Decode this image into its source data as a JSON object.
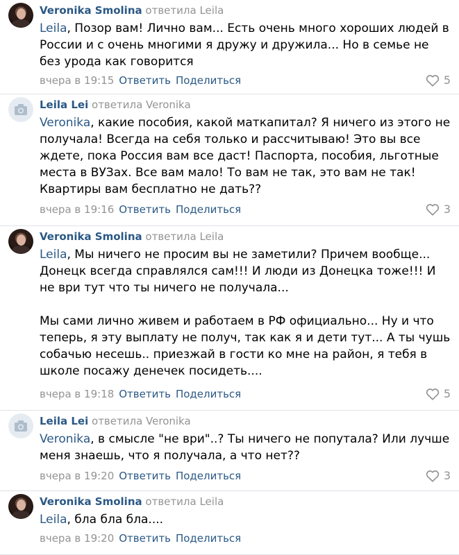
{
  "comments": [
    {
      "author": "Veronika Smolina",
      "replied": "ответила",
      "reply_to": "Leila",
      "mention": "Leila",
      "body": ", Позор вам! Лично вам... Есть очень много хороших людей в России и с очень многими я дружу и дружила... Но в семье не без урода как говорится",
      "date": "вчера в 19:15",
      "reply_label": "Ответить",
      "share_label": "Поделиться",
      "likes": "5",
      "avatar": "photo"
    },
    {
      "author": "Leila Lei",
      "replied": "ответила",
      "reply_to": "Veronika",
      "mention": "Veronika",
      "body": ", какие пособия, какой маткапитал? Я ничего из этого не получала! Всегда на себя только и рассчитываю! Это вы все ждете, пока Россия вам все даст! Паспорта, пособия, льготные места в ВУЗах. Все вам мало! То вам не так, это вам не так! Квартиры вам бесплатно не дать??",
      "date": "вчера в 19:16",
      "reply_label": "Ответить",
      "share_label": "Поделиться",
      "likes": "3",
      "avatar": "camera-placeholder"
    },
    {
      "author": "Veronika Smolina",
      "replied": "ответила",
      "reply_to": "Leila",
      "mention": "Leila",
      "body": ", Мы ничего не просим вы не заметили? Причем вообще... Донецк всегда справлялся сам!!! И люди из Донецка тоже!!! И не ври тут что ты ничего не получала...\n\nМы сами лично живем и работаем в РФ официально... Ну и что теперь, я эту выплату не получ, так как я и дети тут... А ты чушь собачью несешь.. приезжай в гости ко мне на район, я тебя в школе посажу денечек посидеть....",
      "date": "вчера в 19:18",
      "reply_label": "Ответить",
      "share_label": "Поделиться",
      "likes": "5",
      "avatar": "photo"
    },
    {
      "author": "Leila Lei",
      "replied": "ответила",
      "reply_to": "Veronika",
      "mention": "Veronika",
      "body": ", в смысле \"не ври\"..? Ты ничего не попутала? Или лучше меня знаешь, что я получала, а что нет??",
      "date": "вчера в 19:20",
      "reply_label": "Ответить",
      "share_label": "Поделиться",
      "likes": "3",
      "avatar": "camera-placeholder"
    },
    {
      "author": "Veronika Smolina",
      "replied": "ответила",
      "reply_to": "Leila",
      "mention": "Leila",
      "body": ", бла бла бла....",
      "date": "вчера в 19:20",
      "reply_label": "Ответить",
      "share_label": "Поделиться",
      "likes": "",
      "avatar": "photo"
    }
  ],
  "colors": {
    "link": "#2a5885",
    "muted": "#939393",
    "divider": "#dfe2e8"
  }
}
